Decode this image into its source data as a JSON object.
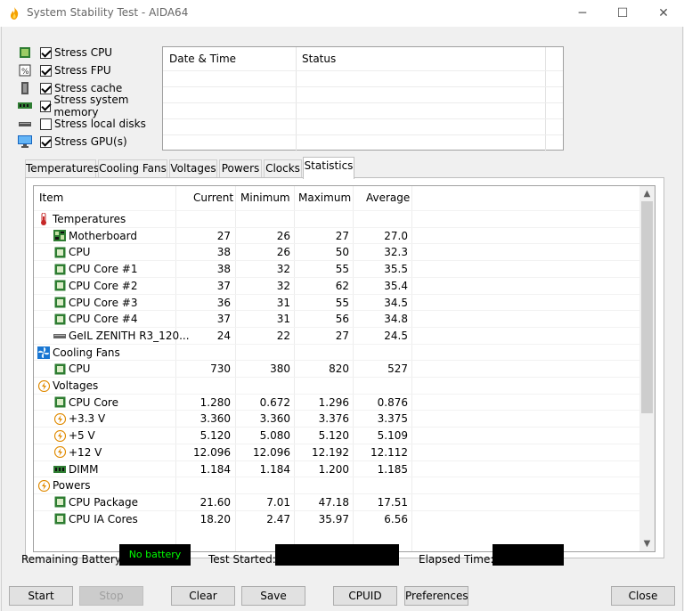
{
  "window": {
    "title": "System Stability Test - AIDA64",
    "min": "─",
    "max": "☐",
    "close": "✕"
  },
  "stress": [
    {
      "label": "Stress CPU",
      "checked": true,
      "icon": "cpu-chip-icon"
    },
    {
      "label": "Stress FPU",
      "checked": true,
      "icon": "fpu-icon"
    },
    {
      "label": "Stress cache",
      "checked": true,
      "icon": "cache-icon"
    },
    {
      "label": "Stress system memory",
      "checked": true,
      "icon": "memory-icon"
    },
    {
      "label": "Stress local disks",
      "checked": false,
      "icon": "disk-icon"
    },
    {
      "label": "Stress GPU(s)",
      "checked": true,
      "icon": "monitor-icon"
    }
  ],
  "log": {
    "col1": "Date & Time",
    "col2": "Status"
  },
  "tabs": [
    "Temperatures",
    "Cooling Fans",
    "Voltages",
    "Powers",
    "Clocks",
    "Statistics"
  ],
  "active_tab": "Statistics",
  "table": {
    "headers": [
      "Item",
      "Current",
      "Minimum",
      "Maximum",
      "Average"
    ],
    "rows": [
      {
        "type": "group",
        "name": "Temperatures",
        "icon": "thermometer-icon"
      },
      {
        "type": "item",
        "name": "Motherboard",
        "icon": "motherboard-icon",
        "cur": "27",
        "min": "26",
        "max": "27",
        "avg": "27.0"
      },
      {
        "type": "item",
        "name": "CPU",
        "icon": "chip-icon",
        "cur": "38",
        "min": "26",
        "max": "50",
        "avg": "32.3"
      },
      {
        "type": "item",
        "name": "CPU Core #1",
        "icon": "chip-icon",
        "cur": "38",
        "min": "32",
        "max": "55",
        "avg": "35.5"
      },
      {
        "type": "item",
        "name": "CPU Core #2",
        "icon": "chip-icon",
        "cur": "37",
        "min": "32",
        "max": "62",
        "avg": "35.4"
      },
      {
        "type": "item",
        "name": "CPU Core #3",
        "icon": "chip-icon",
        "cur": "36",
        "min": "31",
        "max": "55",
        "avg": "34.5"
      },
      {
        "type": "item",
        "name": "CPU Core #4",
        "icon": "chip-icon",
        "cur": "37",
        "min": "31",
        "max": "56",
        "avg": "34.8"
      },
      {
        "type": "item",
        "name": "GeIL ZENITH R3_120...",
        "icon": "ram-stick-icon",
        "cur": "24",
        "min": "22",
        "max": "27",
        "avg": "24.5"
      },
      {
        "type": "group",
        "name": "Cooling Fans",
        "icon": "fan-icon"
      },
      {
        "type": "item",
        "name": "CPU",
        "icon": "chip-icon",
        "cur": "730",
        "min": "380",
        "max": "820",
        "avg": "527"
      },
      {
        "type": "group",
        "name": "Voltages",
        "icon": "lightning-icon"
      },
      {
        "type": "item",
        "name": "CPU Core",
        "icon": "chip-icon",
        "cur": "1.280",
        "min": "0.672",
        "max": "1.296",
        "avg": "0.876"
      },
      {
        "type": "item",
        "name": "+3.3 V",
        "icon": "lightning-icon",
        "cur": "3.360",
        "min": "3.360",
        "max": "3.376",
        "avg": "3.375"
      },
      {
        "type": "item",
        "name": "+5 V",
        "icon": "lightning-icon",
        "cur": "5.120",
        "min": "5.080",
        "max": "5.120",
        "avg": "5.109"
      },
      {
        "type": "item",
        "name": "+12 V",
        "icon": "lightning-icon",
        "cur": "12.096",
        "min": "12.096",
        "max": "12.192",
        "avg": "12.112"
      },
      {
        "type": "item",
        "name": "DIMM",
        "icon": "memory-icon",
        "cur": "1.184",
        "min": "1.184",
        "max": "1.200",
        "avg": "1.185"
      },
      {
        "type": "group",
        "name": "Powers",
        "icon": "lightning-icon"
      },
      {
        "type": "item",
        "name": "CPU Package",
        "icon": "chip-icon",
        "cur": "21.60",
        "min": "7.01",
        "max": "47.18",
        "avg": "17.51"
      },
      {
        "type": "item",
        "name": "CPU IA Cores",
        "icon": "chip-icon",
        "cur": "18.20",
        "min": "2.47",
        "max": "35.97",
        "avg": "6.56"
      }
    ]
  },
  "status": {
    "battery_label": "Remaining Battery:",
    "battery_value": "No battery",
    "started_label": "Test Started:",
    "started_value": "",
    "elapsed_label": "Elapsed Time:",
    "elapsed_value": ""
  },
  "buttons": {
    "start": "Start",
    "stop": "Stop",
    "clear": "Clear",
    "save": "Save",
    "cpuid": "CPUID",
    "preferences": "Preferences",
    "close": "Close"
  },
  "colors": {
    "status_green": "#00ff00",
    "status_bg": "#000000",
    "icon_green": "#2e7d32",
    "lightning_orange": "#e08a00",
    "fan_blue": "#1976d2"
  }
}
